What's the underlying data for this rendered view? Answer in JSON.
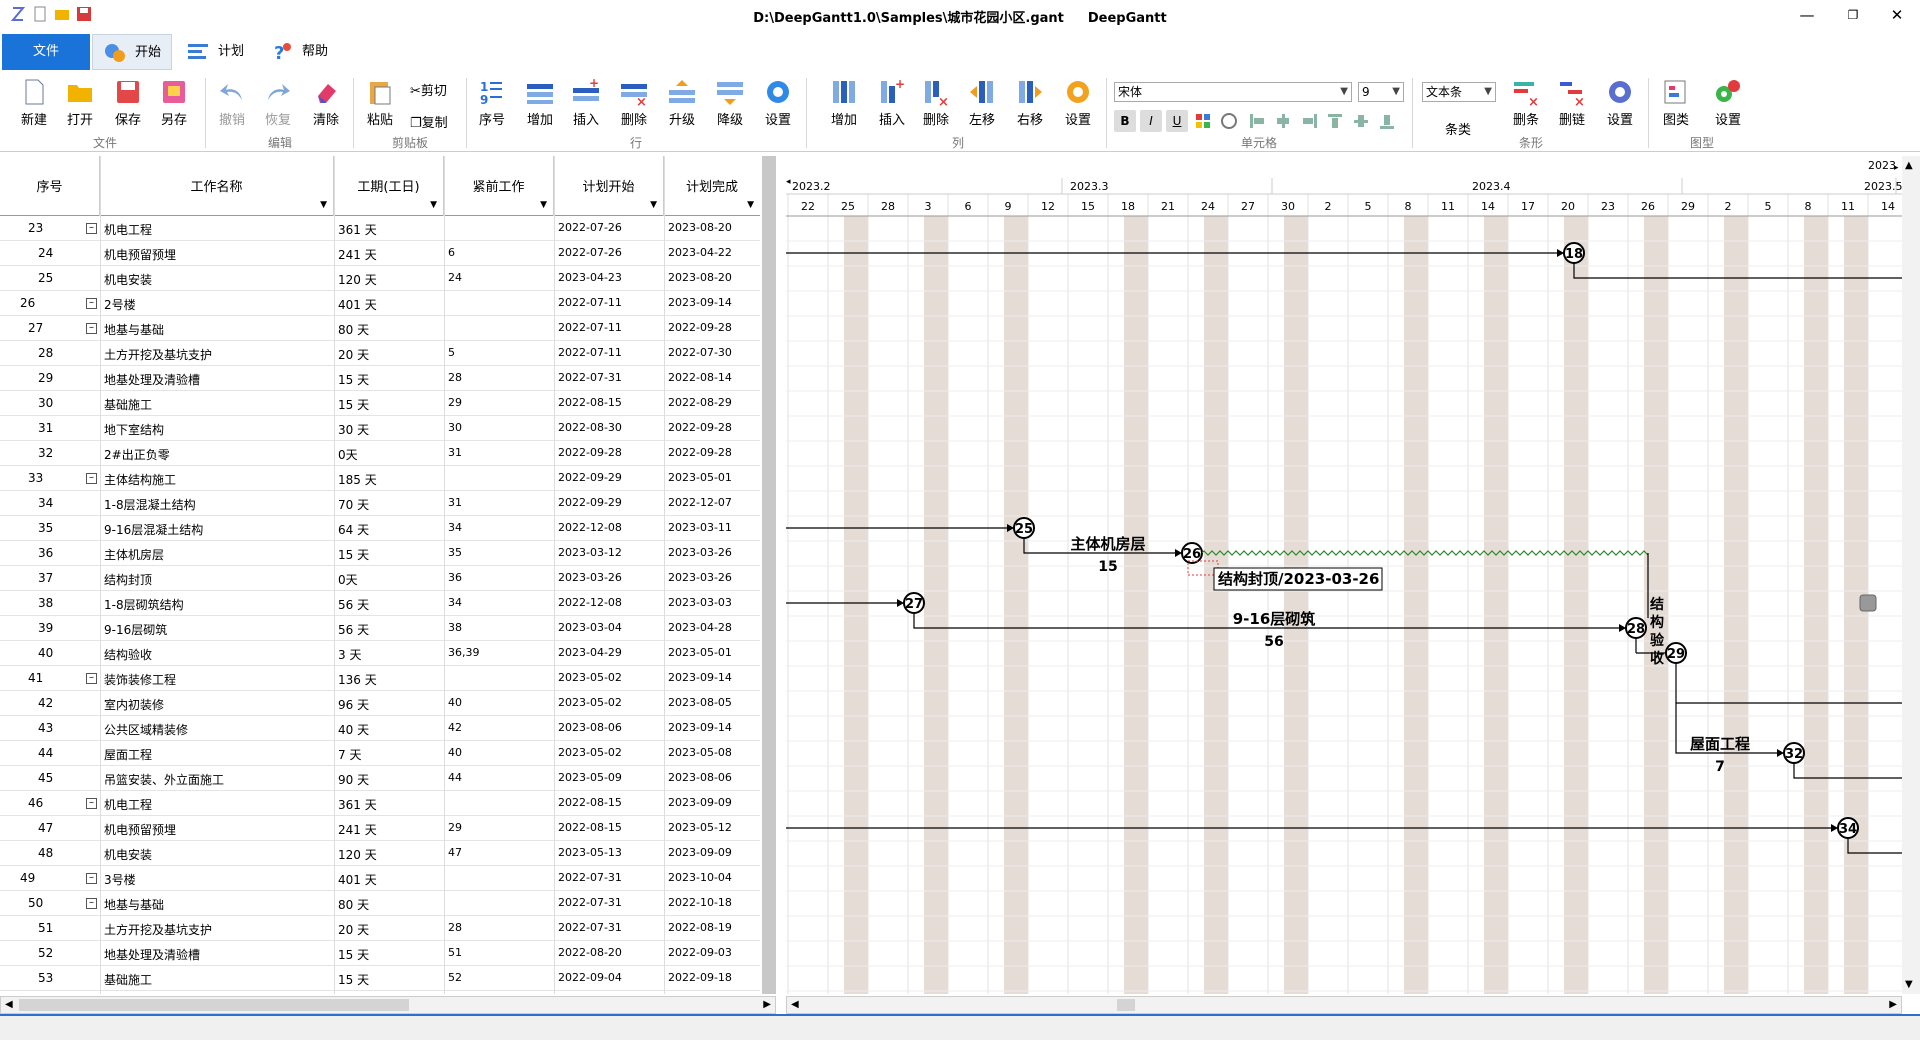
{
  "window": {
    "path": "D:\\DeepGantt1.0\\Samples\\城市花园小区.gant",
    "app": "DeepGantt"
  },
  "tabs": {
    "file": "文件",
    "home": "开始",
    "plan": "计划",
    "help": "帮助"
  },
  "ribbon": {
    "new": "新建",
    "open": "打开",
    "save": "保存",
    "saveas": "另存",
    "undo": "撤销",
    "redo": "恢复",
    "clear": "清除",
    "paste": "粘贴",
    "cut": "剪切",
    "copy": "复制",
    "seq": "序号",
    "row_add": "增加",
    "row_insert": "插入",
    "row_delete": "删除",
    "upgrade": "升级",
    "downgrade": "降级",
    "row_settings": "设置",
    "col_add": "增加",
    "col_insert": "插入",
    "col_delete": "删除",
    "col_left": "左移",
    "col_right": "右移",
    "col_settings": "设置",
    "font_name": "宋体",
    "font_size": "9",
    "bar_style": "文本条",
    "bar_type": "条类",
    "bar_delete": "删条",
    "link_delete": "删链",
    "bar_settings": "设置",
    "chart_type": "图类",
    "chart_settings": "设置",
    "groups": {
      "file": "文件",
      "edit": "编辑",
      "clipboard": "剪贴板",
      "row": "行",
      "col": "列",
      "cell": "单元格",
      "bar": "条形",
      "chart": "图型"
    }
  },
  "columns": [
    "序号",
    "工作名称",
    "工期(工日)",
    "紧前工作",
    "计划开始",
    "计划完成"
  ],
  "rows": [
    {
      "id": "23",
      "name": "机电工程",
      "dur": "361 天",
      "pred": "",
      "start": "2022-07-26",
      "end": "2023-08-20",
      "lvl": 1,
      "grp": true
    },
    {
      "id": "24",
      "name": "机电预留预埋",
      "dur": "241 天",
      "pred": "6",
      "start": "2022-07-26",
      "end": "2023-04-22",
      "lvl": 2,
      "grp": false
    },
    {
      "id": "25",
      "name": "机电安装",
      "dur": "120 天",
      "pred": "24",
      "start": "2023-04-23",
      "end": "2023-08-20",
      "lvl": 2,
      "grp": false
    },
    {
      "id": "26",
      "name": "2号楼",
      "dur": "401 天",
      "pred": "",
      "start": "2022-07-11",
      "end": "2023-09-14",
      "lvl": 0,
      "grp": true
    },
    {
      "id": "27",
      "name": "地基与基础",
      "dur": "80 天",
      "pred": "",
      "start": "2022-07-11",
      "end": "2022-09-28",
      "lvl": 1,
      "grp": true
    },
    {
      "id": "28",
      "name": "土方开挖及基坑支护",
      "dur": "20 天",
      "pred": "5",
      "start": "2022-07-11",
      "end": "2022-07-30",
      "lvl": 2,
      "grp": false
    },
    {
      "id": "29",
      "name": "地基处理及清验槽",
      "dur": "15 天",
      "pred": "28",
      "start": "2022-07-31",
      "end": "2022-08-14",
      "lvl": 2,
      "grp": false
    },
    {
      "id": "30",
      "name": "基础施工",
      "dur": "15 天",
      "pred": "29",
      "start": "2022-08-15",
      "end": "2022-08-29",
      "lvl": 2,
      "grp": false
    },
    {
      "id": "31",
      "name": "地下室结构",
      "dur": "30 天",
      "pred": "30",
      "start": "2022-08-30",
      "end": "2022-09-28",
      "lvl": 2,
      "grp": false
    },
    {
      "id": "32",
      "name": "2#出正负零",
      "dur": "0天",
      "pred": "31",
      "start": "2022-09-28",
      "end": "2022-09-28",
      "lvl": 2,
      "grp": false
    },
    {
      "id": "33",
      "name": "主体结构施工",
      "dur": "185 天",
      "pred": "",
      "start": "2022-09-29",
      "end": "2023-05-01",
      "lvl": 1,
      "grp": true
    },
    {
      "id": "34",
      "name": "1-8层混凝土结构",
      "dur": "70 天",
      "pred": "31",
      "start": "2022-09-29",
      "end": "2022-12-07",
      "lvl": 2,
      "grp": false
    },
    {
      "id": "35",
      "name": "9-16层混凝土结构",
      "dur": "64 天",
      "pred": "34",
      "start": "2022-12-08",
      "end": "2023-03-11",
      "lvl": 2,
      "grp": false
    },
    {
      "id": "36",
      "name": "主体机房层",
      "dur": "15 天",
      "pred": "35",
      "start": "2023-03-12",
      "end": "2023-03-26",
      "lvl": 2,
      "grp": false
    },
    {
      "id": "37",
      "name": "结构封顶",
      "dur": "0天",
      "pred": "36",
      "start": "2023-03-26",
      "end": "2023-03-26",
      "lvl": 2,
      "grp": false
    },
    {
      "id": "38",
      "name": "1-8层砌筑结构",
      "dur": "56 天",
      "pred": "34",
      "start": "2022-12-08",
      "end": "2023-03-03",
      "lvl": 2,
      "grp": false
    },
    {
      "id": "39",
      "name": "9-16层砌筑",
      "dur": "56 天",
      "pred": "38",
      "start": "2023-03-04",
      "end": "2023-04-28",
      "lvl": 2,
      "grp": false
    },
    {
      "id": "40",
      "name": "结构验收",
      "dur": "3 天",
      "pred": "36,39",
      "start": "2023-04-29",
      "end": "2023-05-01",
      "lvl": 2,
      "grp": false
    },
    {
      "id": "41",
      "name": "装饰装修工程",
      "dur": "136 天",
      "pred": "",
      "start": "2023-05-02",
      "end": "2023-09-14",
      "lvl": 1,
      "grp": true
    },
    {
      "id": "42",
      "name": "室内初装修",
      "dur": "96 天",
      "pred": "40",
      "start": "2023-05-02",
      "end": "2023-08-05",
      "lvl": 2,
      "grp": false
    },
    {
      "id": "43",
      "name": "公共区域精装修",
      "dur": "40 天",
      "pred": "42",
      "start": "2023-08-06",
      "end": "2023-09-14",
      "lvl": 2,
      "grp": false
    },
    {
      "id": "44",
      "name": "屋面工程",
      "dur": "7 天",
      "pred": "40",
      "start": "2023-05-02",
      "end": "2023-05-08",
      "lvl": 2,
      "grp": false
    },
    {
      "id": "45",
      "name": "吊篮安装、外立面施工",
      "dur": "90 天",
      "pred": "44",
      "start": "2023-05-09",
      "end": "2023-08-06",
      "lvl": 2,
      "grp": false
    },
    {
      "id": "46",
      "name": "机电工程",
      "dur": "361 天",
      "pred": "",
      "start": "2022-08-15",
      "end": "2023-09-09",
      "lvl": 1,
      "grp": true
    },
    {
      "id": "47",
      "name": "机电预留预埋",
      "dur": "241 天",
      "pred": "29",
      "start": "2022-08-15",
      "end": "2023-05-12",
      "lvl": 2,
      "grp": false
    },
    {
      "id": "48",
      "name": "机电安装",
      "dur": "120 天",
      "pred": "47",
      "start": "2023-05-13",
      "end": "2023-09-09",
      "lvl": 2,
      "grp": false
    },
    {
      "id": "49",
      "name": "3号楼",
      "dur": "401 天",
      "pred": "",
      "start": "2022-07-31",
      "end": "2023-10-04",
      "lvl": 0,
      "grp": true
    },
    {
      "id": "50",
      "name": "地基与基础",
      "dur": "80 天",
      "pred": "",
      "start": "2022-07-31",
      "end": "2022-10-18",
      "lvl": 1,
      "grp": true
    },
    {
      "id": "51",
      "name": "土方开挖及基坑支护",
      "dur": "20 天",
      "pred": "28",
      "start": "2022-07-31",
      "end": "2022-08-19",
      "lvl": 2,
      "grp": false
    },
    {
      "id": "52",
      "name": "地基处理及清验槽",
      "dur": "15 天",
      "pred": "51",
      "start": "2022-08-20",
      "end": "2022-09-03",
      "lvl": 2,
      "grp": false
    },
    {
      "id": "53",
      "name": "基础施工",
      "dur": "15 天",
      "pred": "52",
      "start": "2022-09-04",
      "end": "2022-09-18",
      "lvl": 2,
      "grp": false
    }
  ],
  "gantt": {
    "year_right": "2023",
    "months": [
      "2023.2",
      "2023.3",
      "2023.4",
      "2023.5"
    ],
    "days": [
      "22",
      "25",
      "28",
      "3",
      "6",
      "9",
      "12",
      "15",
      "18",
      "21",
      "24",
      "27",
      "30",
      "2",
      "5",
      "8",
      "11",
      "14",
      "17",
      "20",
      "23",
      "26",
      "29",
      "2",
      "5",
      "8",
      "11",
      "14"
    ],
    "labels": {
      "t36": "主体机房层",
      "t36d": "15",
      "t37": "结构封顶/2023-03-26",
      "t39": "9-16层砌筑",
      "t39d": "56",
      "t40": "结构验收",
      "t44": "屋面工程",
      "t44d": "7"
    },
    "nodes": [
      "18",
      "25",
      "26",
      "27",
      "28",
      "29",
      "32",
      "34"
    ]
  },
  "colors": {
    "accent": "#1a73d9",
    "weekend": "#e6dcd6",
    "float": "#2a8a2a"
  }
}
